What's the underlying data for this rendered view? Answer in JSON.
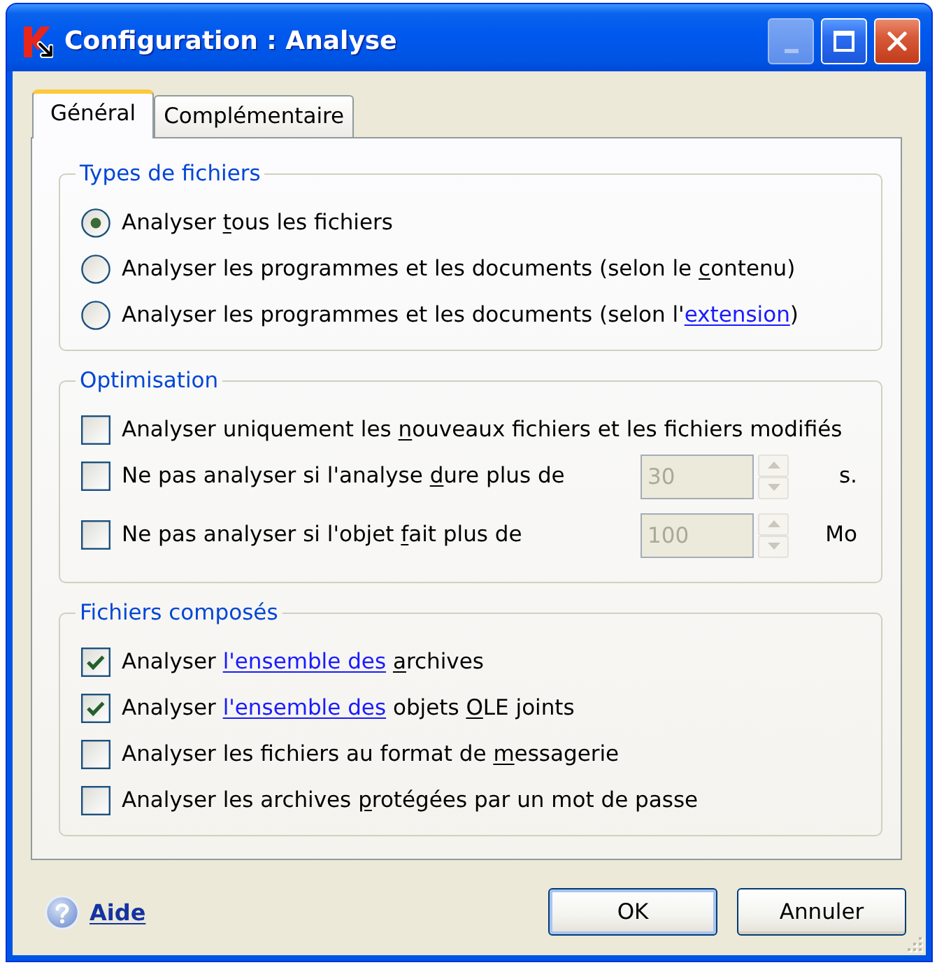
{
  "window": {
    "title": "Configuration : Analyse",
    "controls": [
      {
        "kind": "minimize",
        "disabled": true
      },
      {
        "kind": "maximize",
        "disabled": false
      },
      {
        "kind": "close",
        "disabled": false
      }
    ]
  },
  "tabs": [
    {
      "label": "Général",
      "selected": true
    },
    {
      "label": "Complémentaire",
      "selected": false
    }
  ],
  "groups": [
    {
      "title": "Types de fichiers",
      "options": [
        {
          "kind": "radio",
          "selected": true,
          "label": [
            {
              "kind": "plain",
              "text": "Analyser "
            },
            {
              "kind": "access_key",
              "text": "t"
            },
            {
              "kind": "plain",
              "text": "ous les fichiers"
            }
          ]
        },
        {
          "kind": "radio",
          "selected": false,
          "label": [
            {
              "kind": "plain",
              "text": "Analyser les programmes et les documents (selon le "
            },
            {
              "kind": "access_key",
              "text": "c"
            },
            {
              "kind": "plain",
              "text": "ontenu)"
            }
          ]
        },
        {
          "kind": "radio",
          "selected": false,
          "label": [
            {
              "kind": "plain",
              "text": "Analyser les programmes et les documents (selon l'"
            },
            {
              "kind": "link",
              "text": "extension"
            },
            {
              "kind": "plain",
              "text": ")"
            }
          ]
        }
      ]
    },
    {
      "title": "Optimisation",
      "options": [
        {
          "kind": "checkbox",
          "checked": false,
          "label": [
            {
              "kind": "plain",
              "text": "Analyser uniquement les "
            },
            {
              "kind": "access_key",
              "text": "n"
            },
            {
              "kind": "plain",
              "text": "ouveaux fichiers et les fichiers modifiés"
            }
          ]
        },
        {
          "kind": "checkbox_spin",
          "checked": false,
          "label": [
            {
              "kind": "plain",
              "text": "Ne pas analyser si l'analyse "
            },
            {
              "kind": "access_key",
              "text": "d"
            },
            {
              "kind": "plain",
              "text": "ure plus de"
            }
          ],
          "spin": {
            "value": "30",
            "disabled": true
          },
          "unit": "s."
        },
        {
          "kind": "checkbox_spin",
          "checked": false,
          "label": [
            {
              "kind": "plain",
              "text": "Ne pas analyser si l'objet "
            },
            {
              "kind": "access_key",
              "text": "f"
            },
            {
              "kind": "plain",
              "text": "ait plus de"
            }
          ],
          "spin": {
            "value": "100",
            "disabled": true
          },
          "unit": "Mo"
        }
      ]
    },
    {
      "title": "Fichiers composés",
      "options": [
        {
          "kind": "checkbox",
          "checked": true,
          "label": [
            {
              "kind": "plain",
              "text": "Analyser "
            },
            {
              "kind": "link",
              "text": "l'ensemble des"
            },
            {
              "kind": "space"
            },
            {
              "kind": "access_key",
              "text": "a"
            },
            {
              "kind": "plain",
              "text": "rchives"
            }
          ]
        },
        {
          "kind": "checkbox",
          "checked": true,
          "label": [
            {
              "kind": "plain",
              "text": "Analyser "
            },
            {
              "kind": "link",
              "text": "l'ensemble des"
            },
            {
              "kind": "plain",
              "text": " objets "
            },
            {
              "kind": "access_key",
              "text": "O"
            },
            {
              "kind": "plain",
              "text": "LE joints"
            }
          ]
        },
        {
          "kind": "checkbox",
          "checked": false,
          "label": [
            {
              "kind": "plain",
              "text": "Analyser les fichiers au format de "
            },
            {
              "kind": "access_key",
              "text": "m"
            },
            {
              "kind": "plain",
              "text": "essagerie"
            }
          ]
        },
        {
          "kind": "checkbox",
          "checked": false,
          "label": [
            {
              "kind": "plain",
              "text": "Analyser les archives "
            },
            {
              "kind": "access_key",
              "text": "p"
            },
            {
              "kind": "plain",
              "text": "rotégées par un mot de passe"
            }
          ]
        }
      ]
    }
  ],
  "help": {
    "label": "Aide"
  },
  "buttons": [
    {
      "label": "OK",
      "default": true
    },
    {
      "label": "Annuler",
      "default": false
    }
  ]
}
